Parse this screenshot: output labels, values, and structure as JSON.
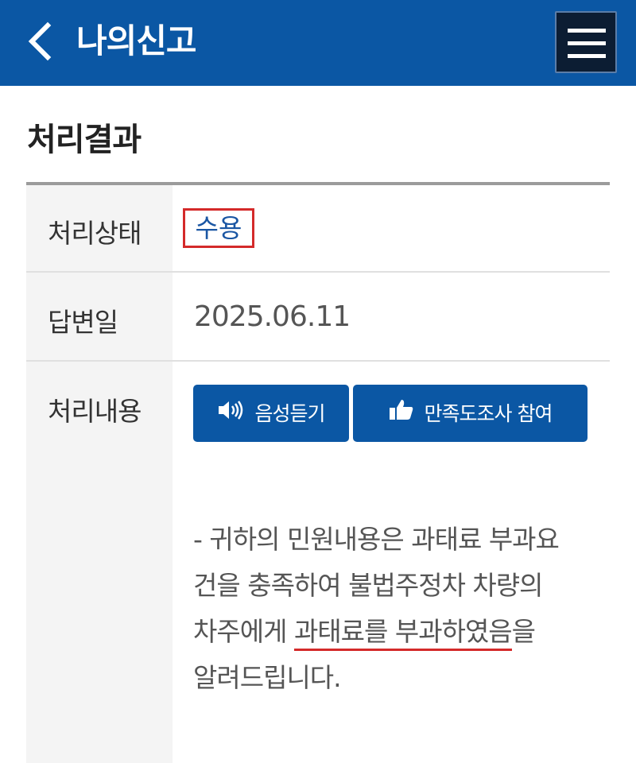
{
  "header": {
    "title": "나의신고",
    "back_icon": "chevron-left-icon",
    "menu_icon": "hamburger-menu-icon",
    "bg_color": "#0b57a4"
  },
  "section": {
    "title": "처리결과"
  },
  "rows": {
    "status": {
      "label": "처리상태",
      "value": "수용"
    },
    "answer_date": {
      "label": "답변일",
      "value": "2025.06.11"
    },
    "content": {
      "label": "처리내용",
      "buttons": {
        "listen": {
          "label": "음성듣기",
          "icon": "speaker-icon"
        },
        "survey": {
          "label": "만족도조사 참여",
          "icon": "thumbs-up-icon"
        }
      },
      "text_lines": {
        "line1": "- 귀하의 민원내용은 과태료 부과요",
        "line2": "건을 충족하여 불법주정차 차량의",
        "line3_prefix": "차주에게 ",
        "line3_underlined": "과태료를 부과하였음",
        "line3_suffix": "을",
        "line4": "알려드립니다."
      }
    }
  },
  "colors": {
    "accent": "#0b57a4",
    "highlight": "#d42a2a",
    "status_text": "#1a56a3"
  }
}
